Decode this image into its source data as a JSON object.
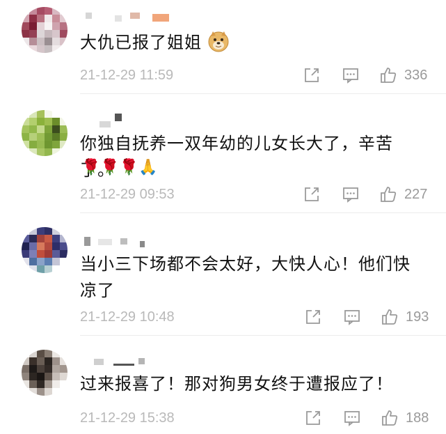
{
  "comments": [
    {
      "text": "大仇已报了姐姐",
      "emoji": "",
      "time": "21-12-29 11:59",
      "likes": "336"
    },
    {
      "text": "你独自抚养一双年幼的儿女长大了，辛苦了。",
      "emoji": "🌹🌹🌹🙏",
      "time": "21-12-29 09:53",
      "likes": "227"
    },
    {
      "text": "当小三下场都不会太好，大快人心！他们快凉了",
      "emoji": "",
      "time": "21-12-29 10:48",
      "likes": "193"
    },
    {
      "text": "过来报喜了！那对狗男女终于遭报应了！",
      "emoji": "",
      "time": "21-12-29 15:38",
      "likes": "188"
    }
  ],
  "icons": {
    "share": "share-icon",
    "reply": "comment-icon",
    "like": "thumbs-up-icon",
    "doge": "doge-emoji"
  },
  "colors": {
    "text": "#111111",
    "meta": "#b9b9b9",
    "icon": "#9a9a9a",
    "divider": "#ececec"
  }
}
